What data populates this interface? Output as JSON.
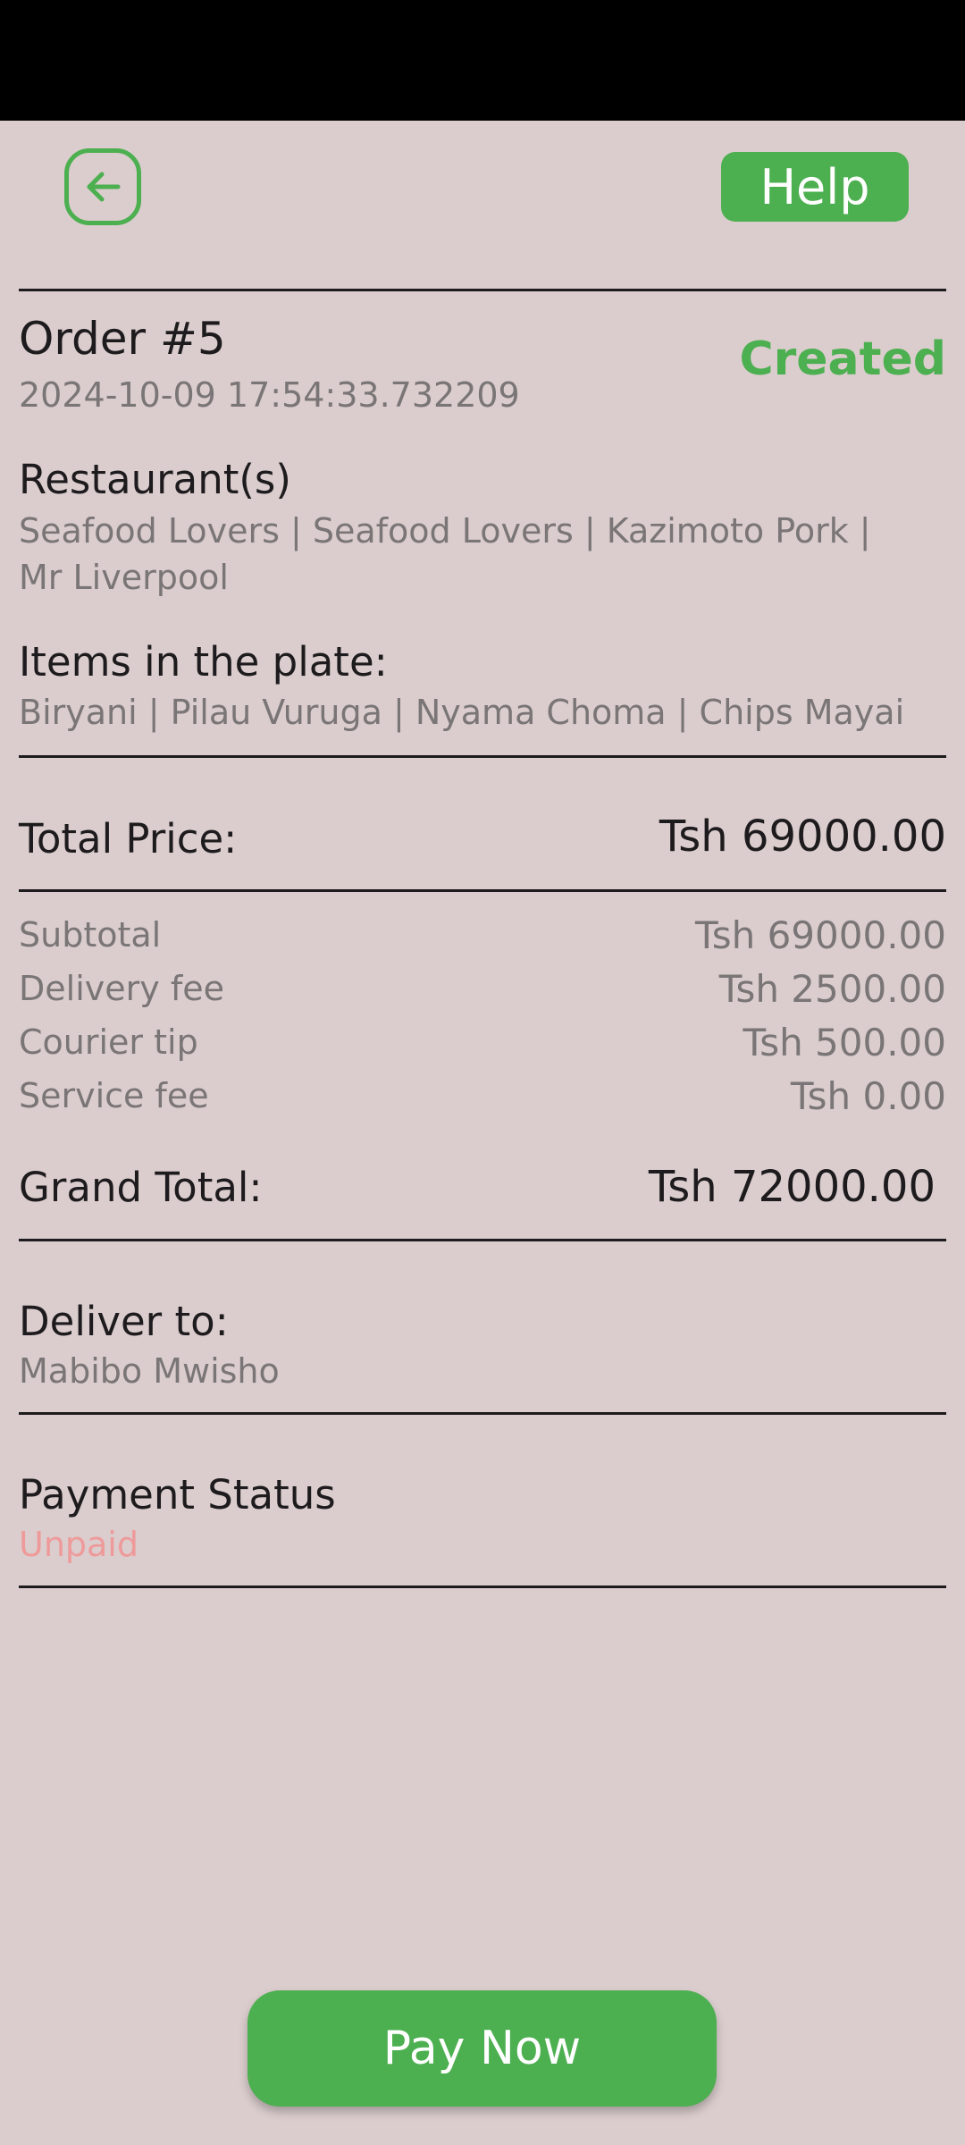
{
  "header": {
    "help_label": "Help"
  },
  "order": {
    "title": "Order #5",
    "timestamp": "2024-10-09 17:54:33.732209",
    "status": "Created"
  },
  "restaurants": {
    "label": "Restaurant(s)",
    "value": "Seafood Lovers | Seafood Lovers | Kazimoto Pork | Mr Liverpool"
  },
  "items": {
    "label": "Items in the plate:",
    "value": "Biryani | Pilau Vuruga | Nyama Choma | Chips Mayai"
  },
  "total_price": {
    "label": "Total Price:",
    "value": "Tsh 69000.00"
  },
  "breakdown": [
    {
      "label": "Subtotal",
      "value": "Tsh 69000.00"
    },
    {
      "label": "Delivery fee",
      "value": "Tsh 2500.00"
    },
    {
      "label": "Courier tip",
      "value": "Tsh 500.00"
    },
    {
      "label": "Service fee",
      "value": "Tsh 0.00"
    }
  ],
  "grand_total": {
    "label": "Grand Total:",
    "value": "Tsh 72000.00"
  },
  "delivery": {
    "label": "Deliver to:",
    "value": "Mabibo Mwisho"
  },
  "payment": {
    "label": "Payment Status",
    "value": "Unpaid"
  },
  "actions": {
    "pay_label": "Pay Now"
  },
  "colors": {
    "accent": "#4caf50",
    "background": "#dbcdcd",
    "unpaid": "#ef9a9a",
    "muted": "#7a7576"
  }
}
